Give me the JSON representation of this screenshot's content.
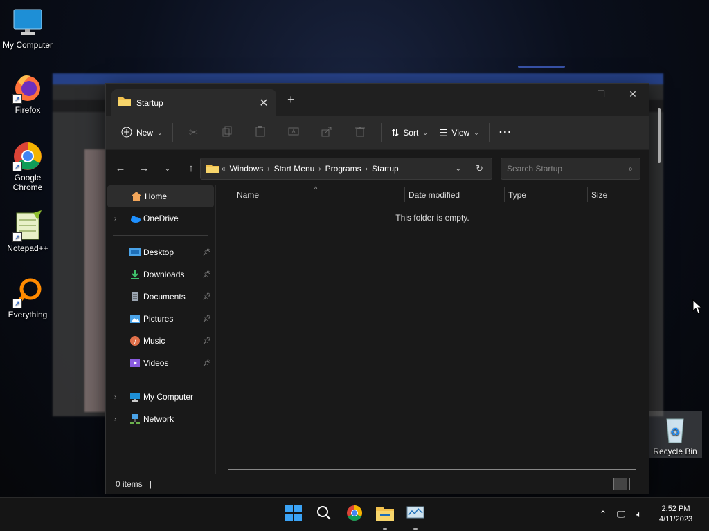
{
  "desktop": {
    "icons": [
      {
        "label": "My Computer"
      },
      {
        "label": "Firefox"
      },
      {
        "label": "Google Chrome"
      },
      {
        "label": "Notepad++"
      },
      {
        "label": "Everything"
      },
      {
        "label": "Recycle Bin"
      }
    ]
  },
  "explorer": {
    "tab_title": "Startup",
    "toolbar": {
      "new_label": "New",
      "sort_label": "Sort",
      "view_label": "View",
      "more_label": "···"
    },
    "breadcrumb": [
      "Windows",
      "Start Menu",
      "Programs",
      "Startup"
    ],
    "search_placeholder": "Search Startup",
    "sidebar": {
      "home": "Home",
      "onedrive": "OneDrive",
      "pinned": [
        {
          "label": "Desktop",
          "icon": "desktop-folder-icon",
          "color": "#4aa3e8"
        },
        {
          "label": "Downloads",
          "icon": "downloads-icon",
          "color": "#3fbf6a"
        },
        {
          "label": "Documents",
          "icon": "documents-icon",
          "color": "#9aa4b0"
        },
        {
          "label": "Pictures",
          "icon": "pictures-icon",
          "color": "#4aa3e8"
        },
        {
          "label": "Music",
          "icon": "music-icon",
          "color": "#e0704a"
        },
        {
          "label": "Videos",
          "icon": "videos-icon",
          "color": "#8a5ce0"
        }
      ],
      "my_computer": "My Computer",
      "network": "Network"
    },
    "columns": {
      "name": "Name",
      "date_modified": "Date modified",
      "type": "Type",
      "size": "Size"
    },
    "empty_message": "This folder is empty.",
    "status_items": "0 items"
  },
  "taskbar": {
    "time": "2:52 PM",
    "date": "4/11/2023"
  },
  "colors": {
    "accent": "#0078d4",
    "folder": "#f2c14e",
    "window_bg": "#191919",
    "toolbar_bg": "#2b2b2b"
  }
}
